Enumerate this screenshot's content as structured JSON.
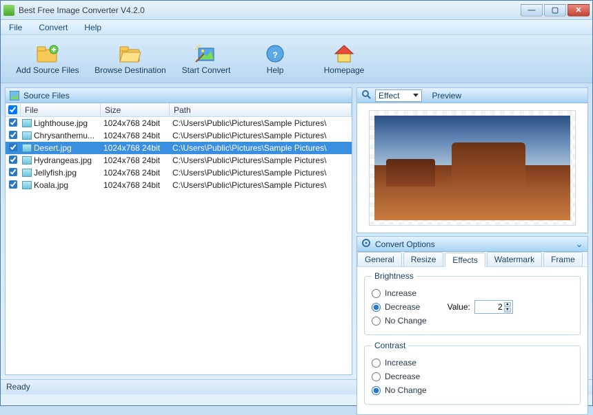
{
  "window": {
    "title": "Best Free Image Converter V4.2.0"
  },
  "menu": {
    "file": "File",
    "convert": "Convert",
    "help": "Help"
  },
  "toolbar": {
    "addSource": "Add Source Files",
    "browseDest": "Browse Destination",
    "startConvert": "Start Convert",
    "help": "Help",
    "homepage": "Homepage"
  },
  "sourcePanel": {
    "title": "Source Files",
    "cols": {
      "file": "File",
      "size": "Size",
      "path": "Path"
    },
    "rows": [
      {
        "file": "Lighthouse.jpg",
        "size": "1024x768  24bit",
        "path": "C:\\Users\\Public\\Pictures\\Sample Pictures\\"
      },
      {
        "file": "Chrysanthemu...",
        "size": "1024x768  24bit",
        "path": "C:\\Users\\Public\\Pictures\\Sample Pictures\\"
      },
      {
        "file": "Desert.jpg",
        "size": "1024x768  24bit",
        "path": "C:\\Users\\Public\\Pictures\\Sample Pictures\\"
      },
      {
        "file": "Hydrangeas.jpg",
        "size": "1024x768  24bit",
        "path": "C:\\Users\\Public\\Pictures\\Sample Pictures\\"
      },
      {
        "file": "Jellyfish.jpg",
        "size": "1024x768  24bit",
        "path": "C:\\Users\\Public\\Pictures\\Sample Pictures\\"
      },
      {
        "file": "Koala.jpg",
        "size": "1024x768  24bit",
        "path": "C:\\Users\\Public\\Pictures\\Sample Pictures\\"
      }
    ],
    "selectedIndex": 2
  },
  "preview": {
    "effectLabel": "Effect",
    "previewLabel": "Preview"
  },
  "convertOptions": {
    "title": "Convert Options",
    "tabs": {
      "general": "General",
      "resize": "Resize",
      "effects": "Effects",
      "watermark": "Watermark",
      "frame": "Frame"
    },
    "activeTab": "effects",
    "brightness": {
      "legend": "Brightness",
      "increase": "Increase",
      "decrease": "Decrease",
      "noChange": "No Change",
      "valueLabel": "Value:",
      "value": "2",
      "selected": "decrease"
    },
    "contrast": {
      "legend": "Contrast",
      "increase": "Increase",
      "decrease": "Decrease",
      "noChange": "No Change",
      "selected": "nochange"
    }
  },
  "status": {
    "text": "Ready"
  }
}
